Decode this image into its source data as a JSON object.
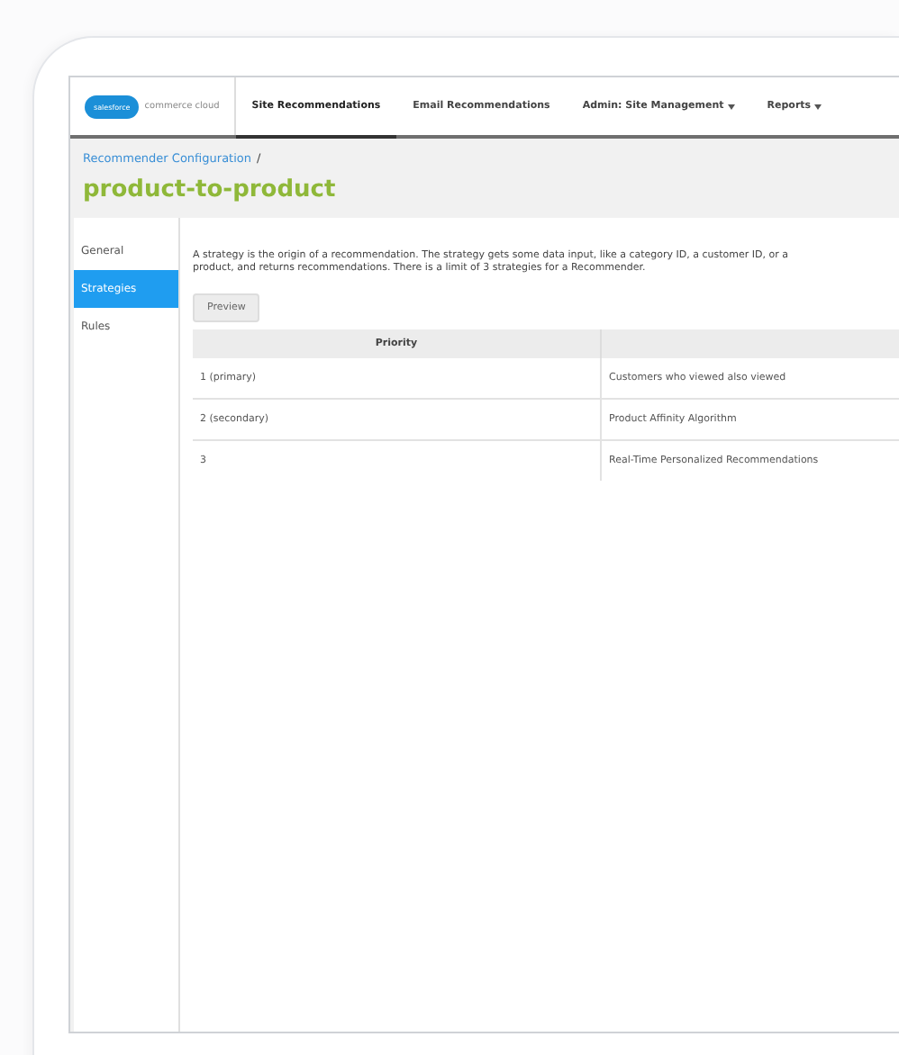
{
  "logo": {
    "badge": "salesforce",
    "product": "commerce cloud"
  },
  "nav": [
    {
      "label": "Site Recommendations",
      "selected": true,
      "has_menu": false
    },
    {
      "label": "Email Recommendations",
      "selected": false,
      "has_menu": false
    },
    {
      "label": "Admin: Site Management",
      "selected": false,
      "has_menu": true
    },
    {
      "label": "Reports",
      "selected": false,
      "has_menu": true
    }
  ],
  "breadcrumb": "Recommender Configuration",
  "breadcrumb_separator": "/",
  "title": "product-to-product",
  "sidebar": [
    {
      "label": "General",
      "selected": false
    },
    {
      "label": "Strategies",
      "selected": true
    },
    {
      "label": "Rules",
      "selected": false
    }
  ],
  "description": "A strategy is the origin of a recommendation. The strategy gets some data input, like a category ID, a customer ID, or a product, and returns recommendations. There is a limit of 3 strategies for a Recommender.",
  "preview_button": "Preview",
  "table": {
    "columns": [
      "Priority"
    ],
    "rows": [
      [
        "1 (primary)",
        "Customers who viewed also viewed"
      ],
      [
        "2 (secondary)",
        "Product Affinity Algorithm"
      ],
      [
        "3",
        "Real-Time Personalized Recommendations"
      ]
    ]
  }
}
